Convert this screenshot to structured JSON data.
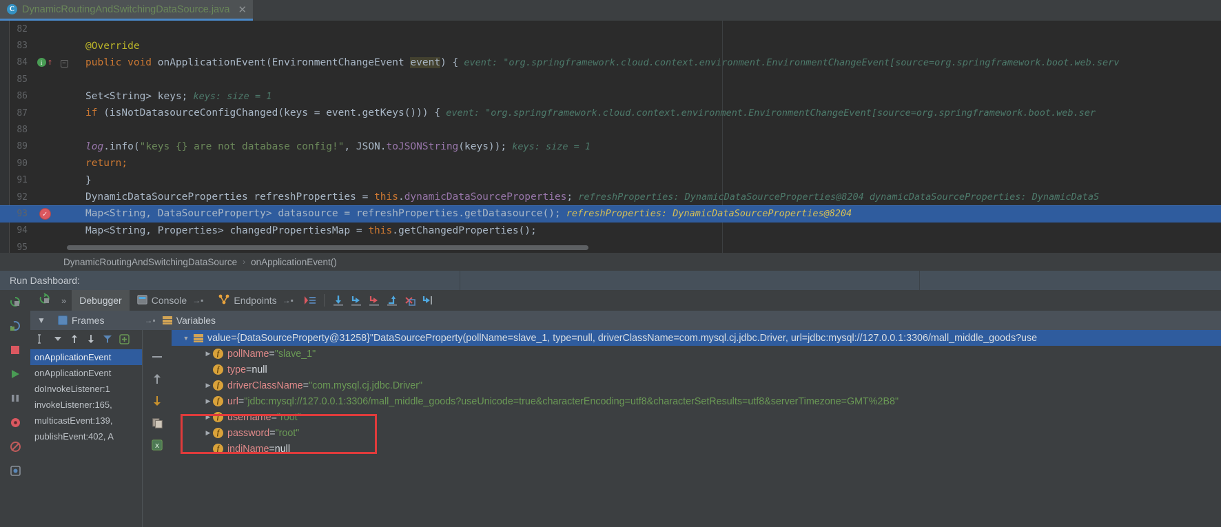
{
  "editor_tab": {
    "filename": "DynamicRoutingAndSwitchingDataSource.java",
    "icon": "class-icon",
    "letter": "C",
    "close": "✕"
  },
  "code": {
    "lines": [
      {
        "num": "82"
      },
      {
        "num": "83",
        "ann": "@Override"
      },
      {
        "num": "84",
        "gutter": "method-run-marker",
        "parts": [
          {
            "t": "public ",
            "c": "kw"
          },
          {
            "t": "void ",
            "c": "kw"
          },
          {
            "t": "onApplicationEvent",
            "c": "txt"
          },
          {
            "t": "(EnvironmentChangeEvent ",
            "c": "txt"
          },
          {
            "t": "event",
            "c": "selparam"
          },
          {
            "t": ") {",
            "c": "txt"
          }
        ],
        "hint": "event:  \"org.springframework.cloud.context.environment.EnvironmentChangeEvent[source=org.springframework.boot.web.serv"
      },
      {
        "num": "85"
      },
      {
        "num": "86",
        "parts": [
          {
            "t": "Set<String> keys;",
            "c": "txt"
          }
        ],
        "hint": "keys:  size = 1"
      },
      {
        "num": "87",
        "parts": [
          {
            "t": "if ",
            "c": "kw"
          },
          {
            "t": "(isNotDatasourceConfigChanged(keys = event.getKeys())) {",
            "c": "txt"
          }
        ],
        "hint": "event:  \"org.springframework.cloud.context.environment.EnvironmentChangeEvent[source=org.springframework.boot.web.ser"
      },
      {
        "num": "88"
      },
      {
        "num": "89",
        "parts": [
          {
            "t": "log",
            "c": "fld"
          },
          {
            "t": ".info(",
            "c": "txt"
          },
          {
            "t": "\"keys {} are not database config!\"",
            "c": "str"
          },
          {
            "t": ", JSON.",
            "c": "txt"
          },
          {
            "t": "toJSONString",
            "c": "sfld"
          },
          {
            "t": "(keys));",
            "c": "txt"
          }
        ],
        "hint": "keys:  size = 1"
      },
      {
        "num": "90",
        "parts": [
          {
            "t": "return;",
            "c": "kw"
          }
        ]
      },
      {
        "num": "91",
        "parts": [
          {
            "t": "}",
            "c": "txt"
          }
        ]
      },
      {
        "num": "92",
        "parts": [
          {
            "t": "DynamicDataSourceProperties refreshProperties = ",
            "c": "txt"
          },
          {
            "t": "this",
            "c": "kw"
          },
          {
            "t": ".",
            "c": "txt"
          },
          {
            "t": "dynamicDataSourceProperties",
            "c": "sfld"
          },
          {
            "t": ";",
            "c": "txt"
          }
        ],
        "hint": "refreshProperties: DynamicDataSourceProperties@8204   dynamicDataSourceProperties: DynamicDataS"
      },
      {
        "num": "93",
        "highlight": true,
        "gutter": "breakpoint",
        "parts": [
          {
            "t": "Map<String, DataSourceProperty> datasource = refreshProperties.getDatasource();",
            "c": "txt"
          }
        ],
        "hintY": "refreshProperties: DynamicDataSourceProperties@8204"
      },
      {
        "num": "94",
        "parts": [
          {
            "t": "Map<String, Properties> changedPropertiesMap = ",
            "c": "txt"
          },
          {
            "t": "this",
            "c": "kw"
          },
          {
            "t": ".getChangedProperties();",
            "c": "txt"
          }
        ]
      },
      {
        "num": "95"
      }
    ]
  },
  "breadcrumb": {
    "class": "DynamicRoutingAndSwitchingDataSource",
    "separator": "›",
    "method": "onApplicationEvent()"
  },
  "run_dashboard": {
    "label": "Run Dashboard:"
  },
  "debug_toolbar": {
    "rerun_icon": "rerun-icon",
    "expand_icon": "»",
    "tabs": [
      {
        "label": "Debugger",
        "active": true,
        "icon": "",
        "pin": ""
      },
      {
        "label": "Console",
        "active": false,
        "icon": "console-icon",
        "pin": "→▪"
      },
      {
        "label": "Endpoints",
        "active": false,
        "icon": "endpoints-icon",
        "pin": "→▪"
      }
    ],
    "buttons": [
      "show-execution-point-icon",
      "step-over-icon",
      "step-into-icon",
      "force-step-into-icon",
      "step-out-icon",
      "drop-frame-icon",
      "run-to-cursor-icon",
      "evaluate-expression-icon",
      "settings-icon"
    ]
  },
  "panels": {
    "collapse_icon": "▼",
    "frames": {
      "label": "Frames",
      "icon": "frames-icon",
      "pin": "→▪"
    },
    "variables": {
      "label": "Variables",
      "icon": "variables-icon"
    }
  },
  "frames": {
    "toolbar": [
      "thread-selector",
      "dropdown-arrow",
      "up-arrow",
      "down-arrow",
      "filter-icon",
      "mute-icon"
    ],
    "items": [
      {
        "label": "onApplicationEvent",
        "selected": true
      },
      {
        "label": "onApplicationEvent",
        "selected": false
      },
      {
        "label": "doInvokeListener:1",
        "selected": false
      },
      {
        "label": "invokeListener:165,",
        "selected": false
      },
      {
        "label": "multicastEvent:139,",
        "selected": false
      },
      {
        "label": "publishEvent:402, A",
        "selected": false
      }
    ]
  },
  "variables": {
    "rows": [
      {
        "indent": 0,
        "arrow": "▼",
        "icon": "variables-icon",
        "selected": true,
        "name": "value",
        "eq": " = ",
        "obj": "{DataSourceProperty@31258} ",
        "str": "\"DataSourceProperty(pollName=slave_1, type=null, driverClassName=com.mysql.cj.jdbc.Driver, url=jdbc:mysql://127.0.0.1:3306/mall_middle_goods?use"
      },
      {
        "indent": 1,
        "arrow": "▶",
        "icon": "field-icon",
        "name": "pollName",
        "eq": " = ",
        "str": "\"slave_1\""
      },
      {
        "indent": 1,
        "arrow": "",
        "icon": "field-icon",
        "name": "type",
        "eq": " = ",
        "nullv": "null"
      },
      {
        "indent": 1,
        "arrow": "▶",
        "icon": "field-icon",
        "name": "driverClassName",
        "eq": " = ",
        "str": "\"com.mysql.cj.jdbc.Driver\""
      },
      {
        "indent": 1,
        "arrow": "▶",
        "icon": "field-icon",
        "name": "url",
        "eq": " = ",
        "str": "\"jdbc:mysql://127.0.0.1:3306/mall_middle_goods?useUnicode=true&characterEncoding=utf8&characterSetResults=utf8&serverTimezone=GMT%2B8\""
      },
      {
        "indent": 1,
        "arrow": "▶",
        "icon": "field-icon",
        "name": "username",
        "eq": " = ",
        "str": "\"root\""
      },
      {
        "indent": 1,
        "arrow": "▶",
        "icon": "field-icon",
        "name": "password",
        "eq": " = ",
        "str": "\"root\""
      },
      {
        "indent": 1,
        "arrow": "",
        "icon": "field-icon",
        "name": "jndiName",
        "eq": " = ",
        "nullv": "null"
      }
    ]
  },
  "annotation": {
    "color": "#e03b3b",
    "shape": "rectangle"
  },
  "colors": {
    "accent": "#2f5c9e",
    "breakpoint": "#db5860",
    "string": "#6a8759",
    "keyword": "#cc7832"
  }
}
